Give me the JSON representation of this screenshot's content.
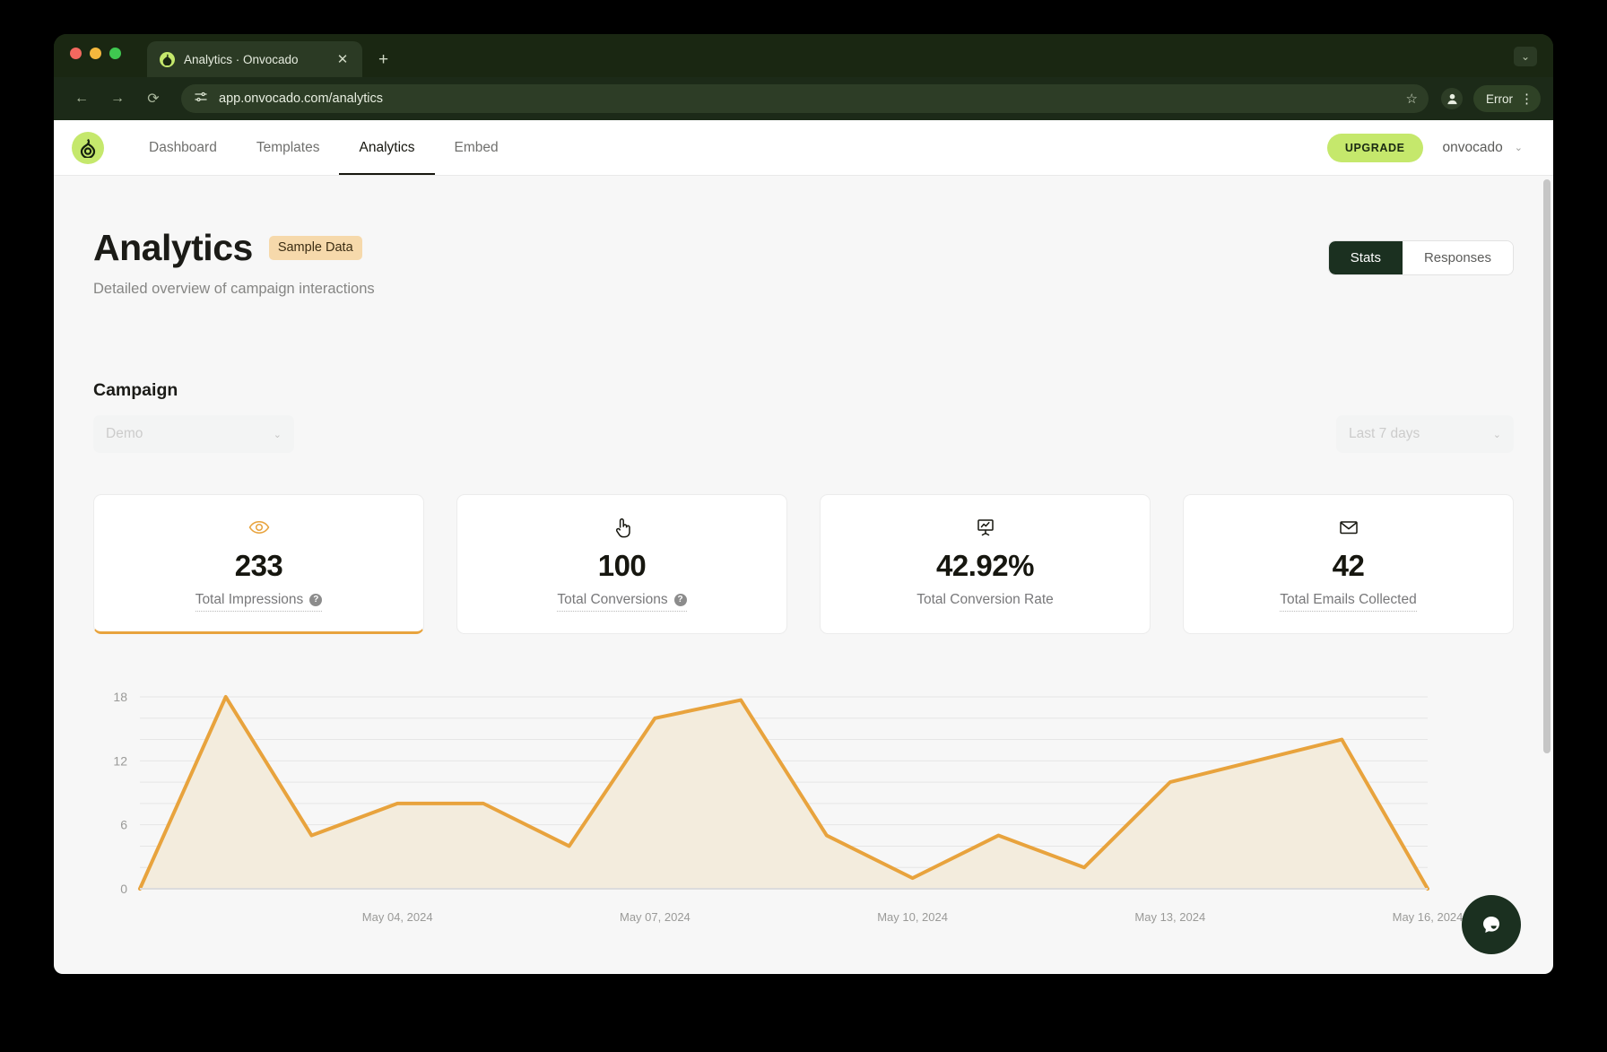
{
  "browser": {
    "tab": {
      "title": "Analytics · Onvocado",
      "favicon": "avocado-icon",
      "close": "✕"
    },
    "new_tab": "+",
    "tabstrip_chevron": "⌄",
    "toolbar": {
      "back": "←",
      "forward": "→",
      "reload": "⟳",
      "site_settings_icon": "tune-icon",
      "url": "app.onvocado.com/analytics",
      "star": "☆",
      "profile_icon": "person-icon",
      "error_label": "Error",
      "menu": "⋮"
    }
  },
  "app": {
    "logo": "avocado-logo",
    "nav": [
      {
        "label": "Dashboard",
        "active": false
      },
      {
        "label": "Templates",
        "active": false
      },
      {
        "label": "Analytics",
        "active": true
      },
      {
        "label": "Embed",
        "active": false
      }
    ],
    "upgrade_label": "UPGRADE",
    "account_name": "onvocado",
    "account_chevron": "⌄"
  },
  "page": {
    "title": "Analytics",
    "badge": "Sample Data",
    "subtitle": "Detailed overview of campaign interactions",
    "view_toggle": [
      {
        "label": "Stats",
        "active": true
      },
      {
        "label": "Responses",
        "active": false
      }
    ],
    "campaign": {
      "label": "Campaign",
      "select_value": "Demo",
      "select_chevron": "⌄",
      "range_value": "Last 7 days",
      "range_chevron": "⌄"
    },
    "stats": [
      {
        "icon": "eye-icon",
        "value": "233",
        "label": "Total Impressions",
        "has_help": true,
        "dotted": true,
        "highlight": true,
        "accent": "#e8a33d"
      },
      {
        "icon": "pointer-hand-icon",
        "value": "100",
        "label": "Total Conversions",
        "has_help": true,
        "dotted": true,
        "highlight": false
      },
      {
        "icon": "presentation-chart-icon",
        "value": "42.92%",
        "label": "Total Conversion Rate",
        "has_help": false,
        "dotted": false,
        "highlight": false
      },
      {
        "icon": "envelope-icon",
        "value": "42",
        "label": "Total Emails Collected",
        "has_help": false,
        "dotted": true,
        "highlight": false
      }
    ],
    "chat_fab_icon": "chat-bubble-icon"
  },
  "chart_data": {
    "type": "area",
    "title": "",
    "xlabel": "",
    "ylabel": "",
    "line_color": "#e8a33d",
    "fill_color": "#f3ecdd",
    "grid": true,
    "ylim": [
      0,
      18
    ],
    "yticks": [
      0,
      6,
      12,
      18
    ],
    "ytick_labels": [
      "0",
      "6",
      "12",
      "18"
    ],
    "gridline_step": 2,
    "x_tick_labels": [
      "May 04, 2024",
      "May 07, 2024",
      "May 10, 2024",
      "May 13, 2024",
      "May 16, 2024"
    ],
    "x_tick_indices": [
      3,
      6,
      9,
      12,
      15
    ],
    "x": [
      "May 01, 2024",
      "May 02, 2024",
      "May 03, 2024",
      "May 04, 2024",
      "May 05, 2024",
      "May 06, 2024",
      "May 07, 2024",
      "May 08, 2024",
      "May 09, 2024",
      "May 10, 2024",
      "May 11, 2024",
      "May 12, 2024",
      "May 13, 2024",
      "May 14, 2024",
      "May 15, 2024",
      "May 16, 2024"
    ],
    "values": [
      0,
      18,
      5,
      8,
      8,
      4,
      16,
      17.7,
      5,
      1,
      5,
      2,
      10,
      12,
      14,
      0
    ]
  }
}
